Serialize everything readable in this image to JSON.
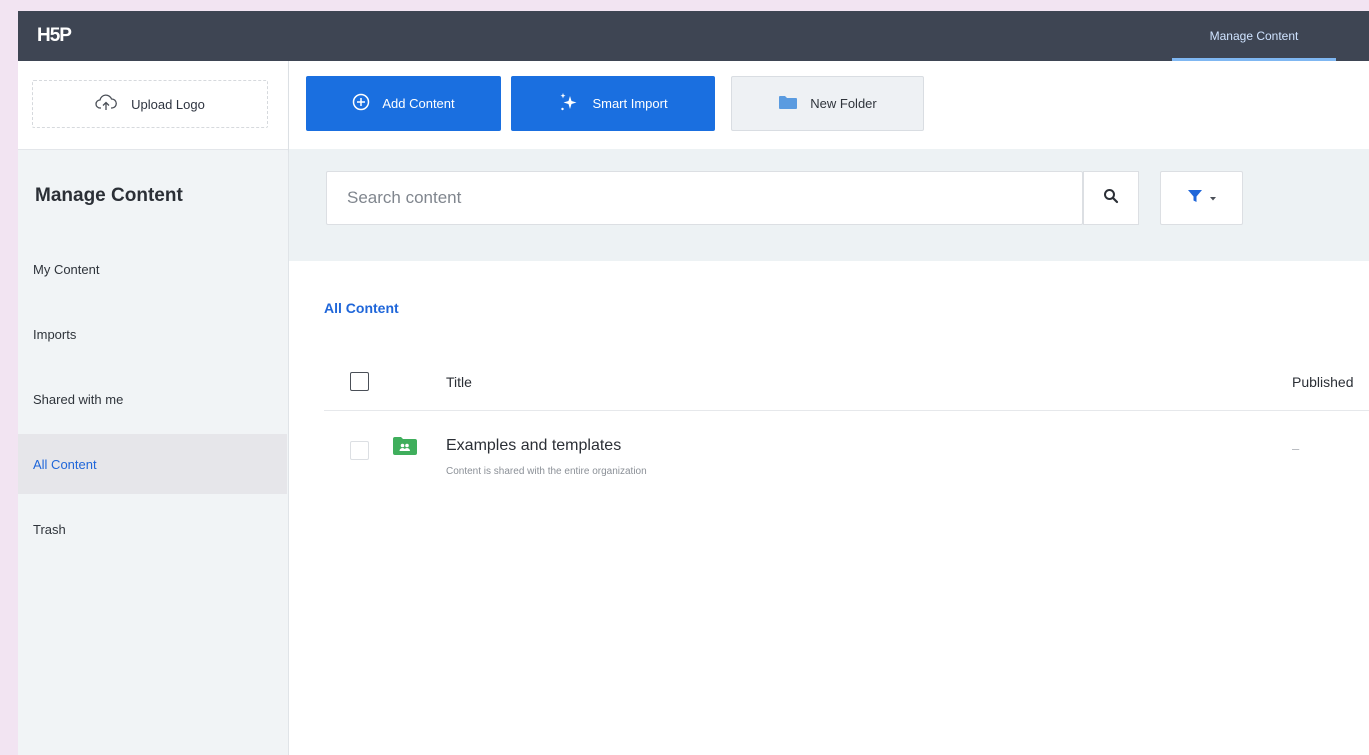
{
  "topbar": {
    "logo": "H5P",
    "tab_label": "Manage Content"
  },
  "sidebar": {
    "upload_label": "Upload Logo",
    "title": "Manage Content",
    "items": [
      {
        "label": "My Content"
      },
      {
        "label": "Imports"
      },
      {
        "label": "Shared with me"
      },
      {
        "label": "All Content"
      },
      {
        "label": "Trash"
      }
    ]
  },
  "toolbar": {
    "add_label": "Add Content",
    "import_label": "Smart Import",
    "folder_label": "New Folder"
  },
  "search": {
    "placeholder": "Search content",
    "value": ""
  },
  "breadcrumb": "All Content",
  "table": {
    "columns": [
      "Title",
      "Published"
    ],
    "rows": [
      {
        "title": "Examples and templates",
        "subtitle": "Content is shared with the entire organization",
        "published": "–"
      }
    ]
  },
  "colors": {
    "topbar": "#3e4553",
    "primary": "#1a6fe0",
    "active_link": "#1f66d9",
    "shared_folder": "#3fae5c",
    "folder": "#5a9be0"
  }
}
